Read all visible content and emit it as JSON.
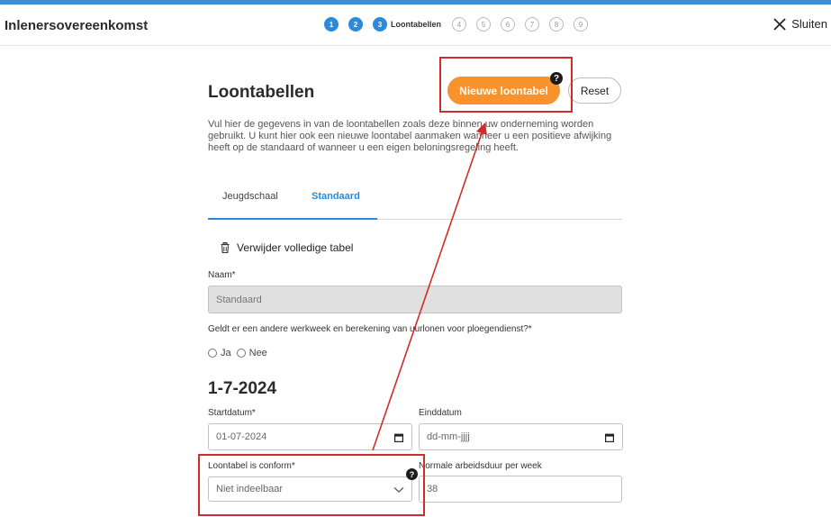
{
  "header": {
    "title": "Inlenersovereenkomst",
    "steps": [
      "1",
      "2",
      "3",
      "4",
      "5",
      "6",
      "7",
      "8",
      "9"
    ],
    "active_step_label": "Loontabellen",
    "close_label": "Sluiten"
  },
  "main": {
    "title": "Loontabellen",
    "new_button": "Nieuwe loontabel",
    "help_glyph": "?",
    "reset_button": "Reset",
    "intro": "Vul hier de gegevens in van de loontabellen zoals deze binnen uw onderneming worden gebruikt. U kunt hier ook een nieuwe loontabel aanmaken wanneer u een positieve afwijking heeft op de standaard of wanneer u een eigen beloningsregeling heeft.",
    "tabs": [
      "Jeugdschaal",
      "Standaard"
    ],
    "delete_label": "Verwijder volledige tabel",
    "name_label": "Naam*",
    "name_value": "Standaard",
    "question": "Geldt er een andere werkweek en berekening van uurlonen voor ploegendienst?*",
    "radio_ja": "Ja",
    "radio_nee": "Nee",
    "date_heading": "1-7-2024",
    "startdatum_label": "Startdatum*",
    "startdatum_value": "01-07-2024",
    "einddatum_label": "Einddatum",
    "einddatum_placeholder": "dd-mm-jjjj",
    "conform_label": "Loontabel is conform*",
    "conform_value": "Niet indeelbaar",
    "arbeidsduur_label": "Normale arbeidsduur per week",
    "arbeidsduur_value": "38"
  },
  "colors": {
    "accent": "#2e8ad8",
    "primary_button": "#f7922c",
    "annotation": "#d32b2b"
  }
}
